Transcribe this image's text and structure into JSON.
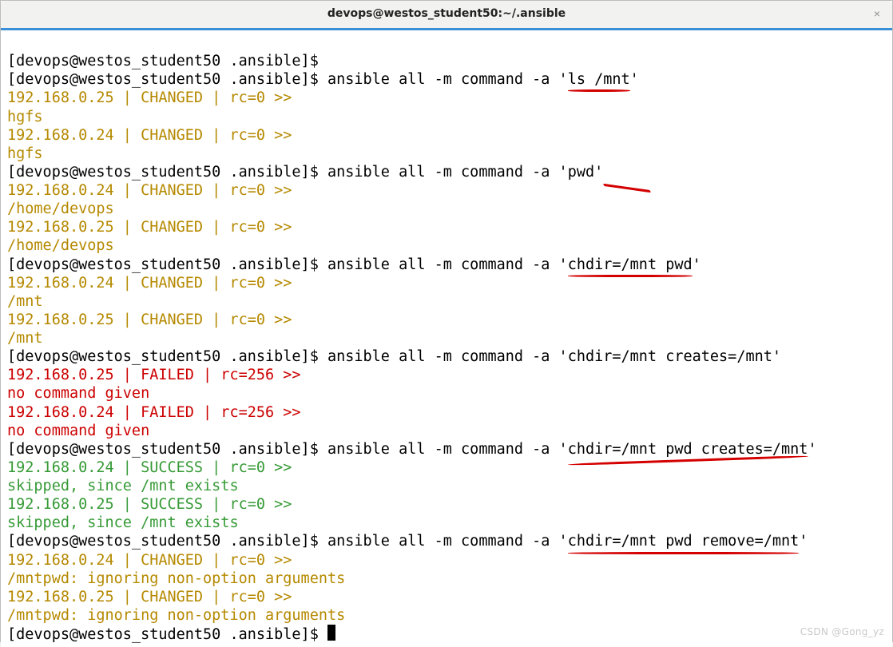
{
  "window": {
    "title": "devops@westos_student50:~/.ansible",
    "close_symbol": "×"
  },
  "prompt": "[devops@westos_student50 .ansible]$ ",
  "lines": {
    "l01_cmd": "",
    "l02_cmd_a": "ansible all -m command -a '",
    "l02_cmd_b": "ls /mnt",
    "l02_cmd_c": "'",
    "l03": "192.168.0.25 | CHANGED | rc=0 >>",
    "l04": "hgfs",
    "l05": "192.168.0.24 | CHANGED | rc=0 >>",
    "l06": "hgfs",
    "l07_cmd_a": "ansible all -m command -a '",
    "l07_cmd_b": "pwd",
    "l07_cmd_c": "'",
    "l08": "192.168.0.24 | CHANGED | rc=0 >>",
    "l09": "/home/devops",
    "l10": "192.168.0.25 | CHANGED | rc=0 >>",
    "l11": "/home/devops",
    "l12_cmd_a": "ansible all -m command -a '",
    "l12_cmd_b": "chdir=/mnt pwd",
    "l12_cmd_c": "'",
    "l13": "192.168.0.24 | CHANGED | rc=0 >>",
    "l14": "/mnt",
    "l15": "192.168.0.25 | CHANGED | rc=0 >>",
    "l16": "/mnt",
    "l17_cmd": "ansible all -m command -a 'chdir=/mnt creates=/mnt'",
    "l18": "192.168.0.25 | FAILED | rc=256 >>",
    "l19": "no command given",
    "l20": "192.168.0.24 | FAILED | rc=256 >>",
    "l21": "no command given",
    "l22_cmd_a": "ansible all -m command -a '",
    "l22_cmd_b": "chdir=/mnt pwd creates=/mnt",
    "l22_cmd_c": "'",
    "l23": "192.168.0.24 | SUCCESS | rc=0 >>",
    "l24": "skipped, since /mnt exists",
    "l25": "192.168.0.25 | SUCCESS | rc=0 >>",
    "l26": "skipped, since /mnt exists",
    "l27_cmd_a": "ansible all -m command -a '",
    "l27_cmd_b": "chdir=/mnt pwd remove=/mnt",
    "l27_cmd_c": "'",
    "l28": "192.168.0.24 | CHANGED | rc=0 >>",
    "l29": "/mntpwd: ignoring non-option arguments",
    "l30": "192.168.0.25 | CHANGED | rc=0 >>",
    "l31": "/mntpwd: ignoring non-option arguments",
    "l32_cmd": ""
  },
  "watermark": "CSDN @Gong_yz"
}
